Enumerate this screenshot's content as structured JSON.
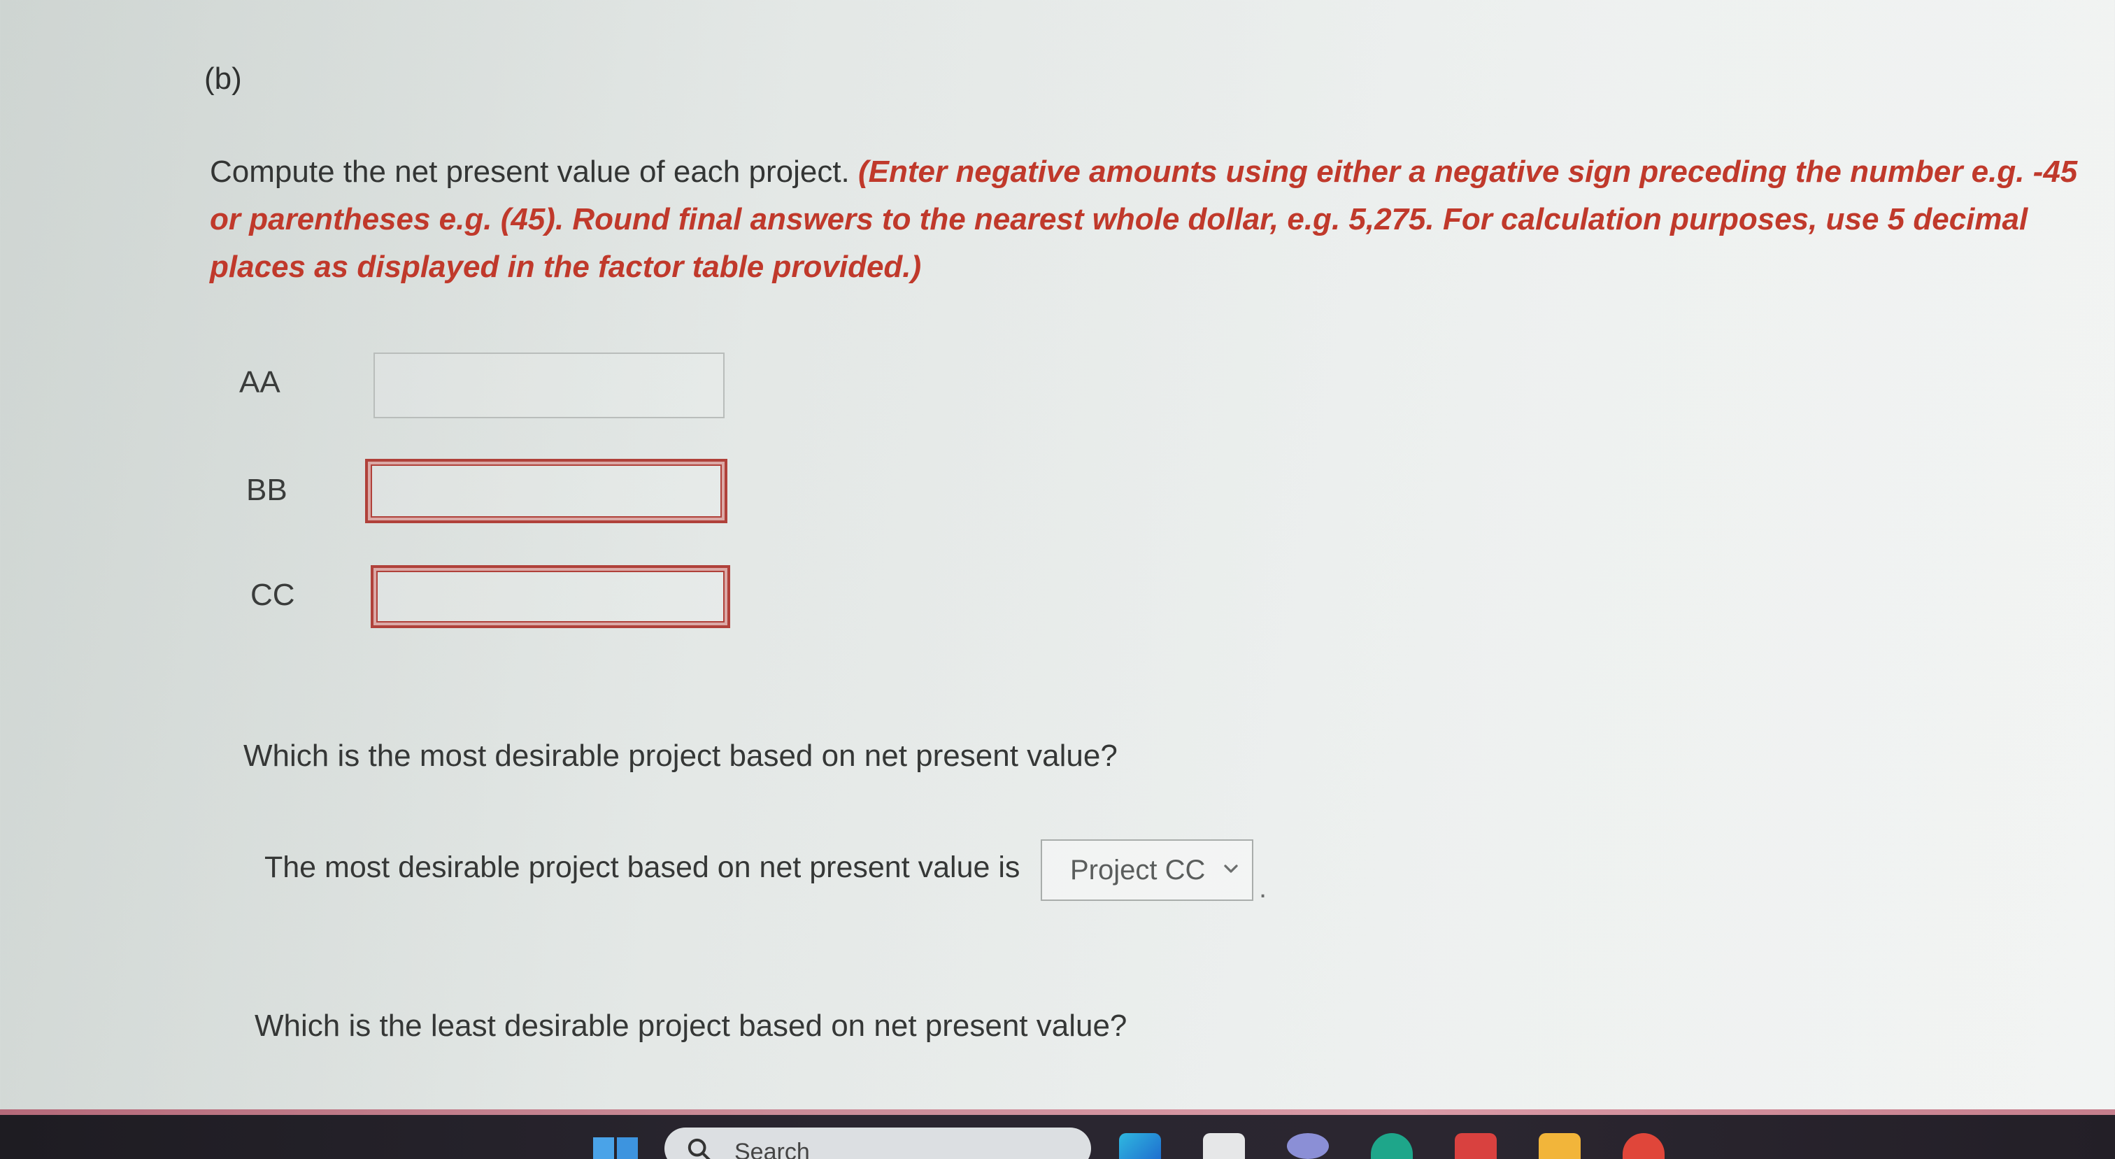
{
  "part_label": "(b)",
  "instructions": {
    "lead": "Compute the net present value of each project. ",
    "note": "(Enter negative amounts using either a negative sign preceding the number e.g. -45 or parentheses e.g. (45). Round final answers to the nearest whole dollar, e.g. 5,275. For calculation purposes, use 5 decimal places as displayed in the factor table provided.)"
  },
  "projects": [
    {
      "label": "AA",
      "value": ""
    },
    {
      "label": "BB",
      "value": ""
    },
    {
      "label": "CC",
      "value": ""
    }
  ],
  "question_most": "Which is the most desirable project based on net present value?",
  "answer_most": {
    "prefix": "The most desirable project based on net present value is",
    "selected": "Project CC",
    "suffix": "."
  },
  "question_least": "Which is the least desirable project based on net present value?",
  "taskbar": {
    "search_label": "Search",
    "icons": [
      "windows-start-icon",
      "search-icon",
      "edge-icon",
      "file-explorer-icon",
      "mail-icon",
      "teams-icon",
      "outlook-icon",
      "folder-icon",
      "chrome-icon"
    ]
  },
  "colors": {
    "instruction_note": "#c0392b",
    "error_border": "#b0413a",
    "taskbar": "#2a2630"
  }
}
